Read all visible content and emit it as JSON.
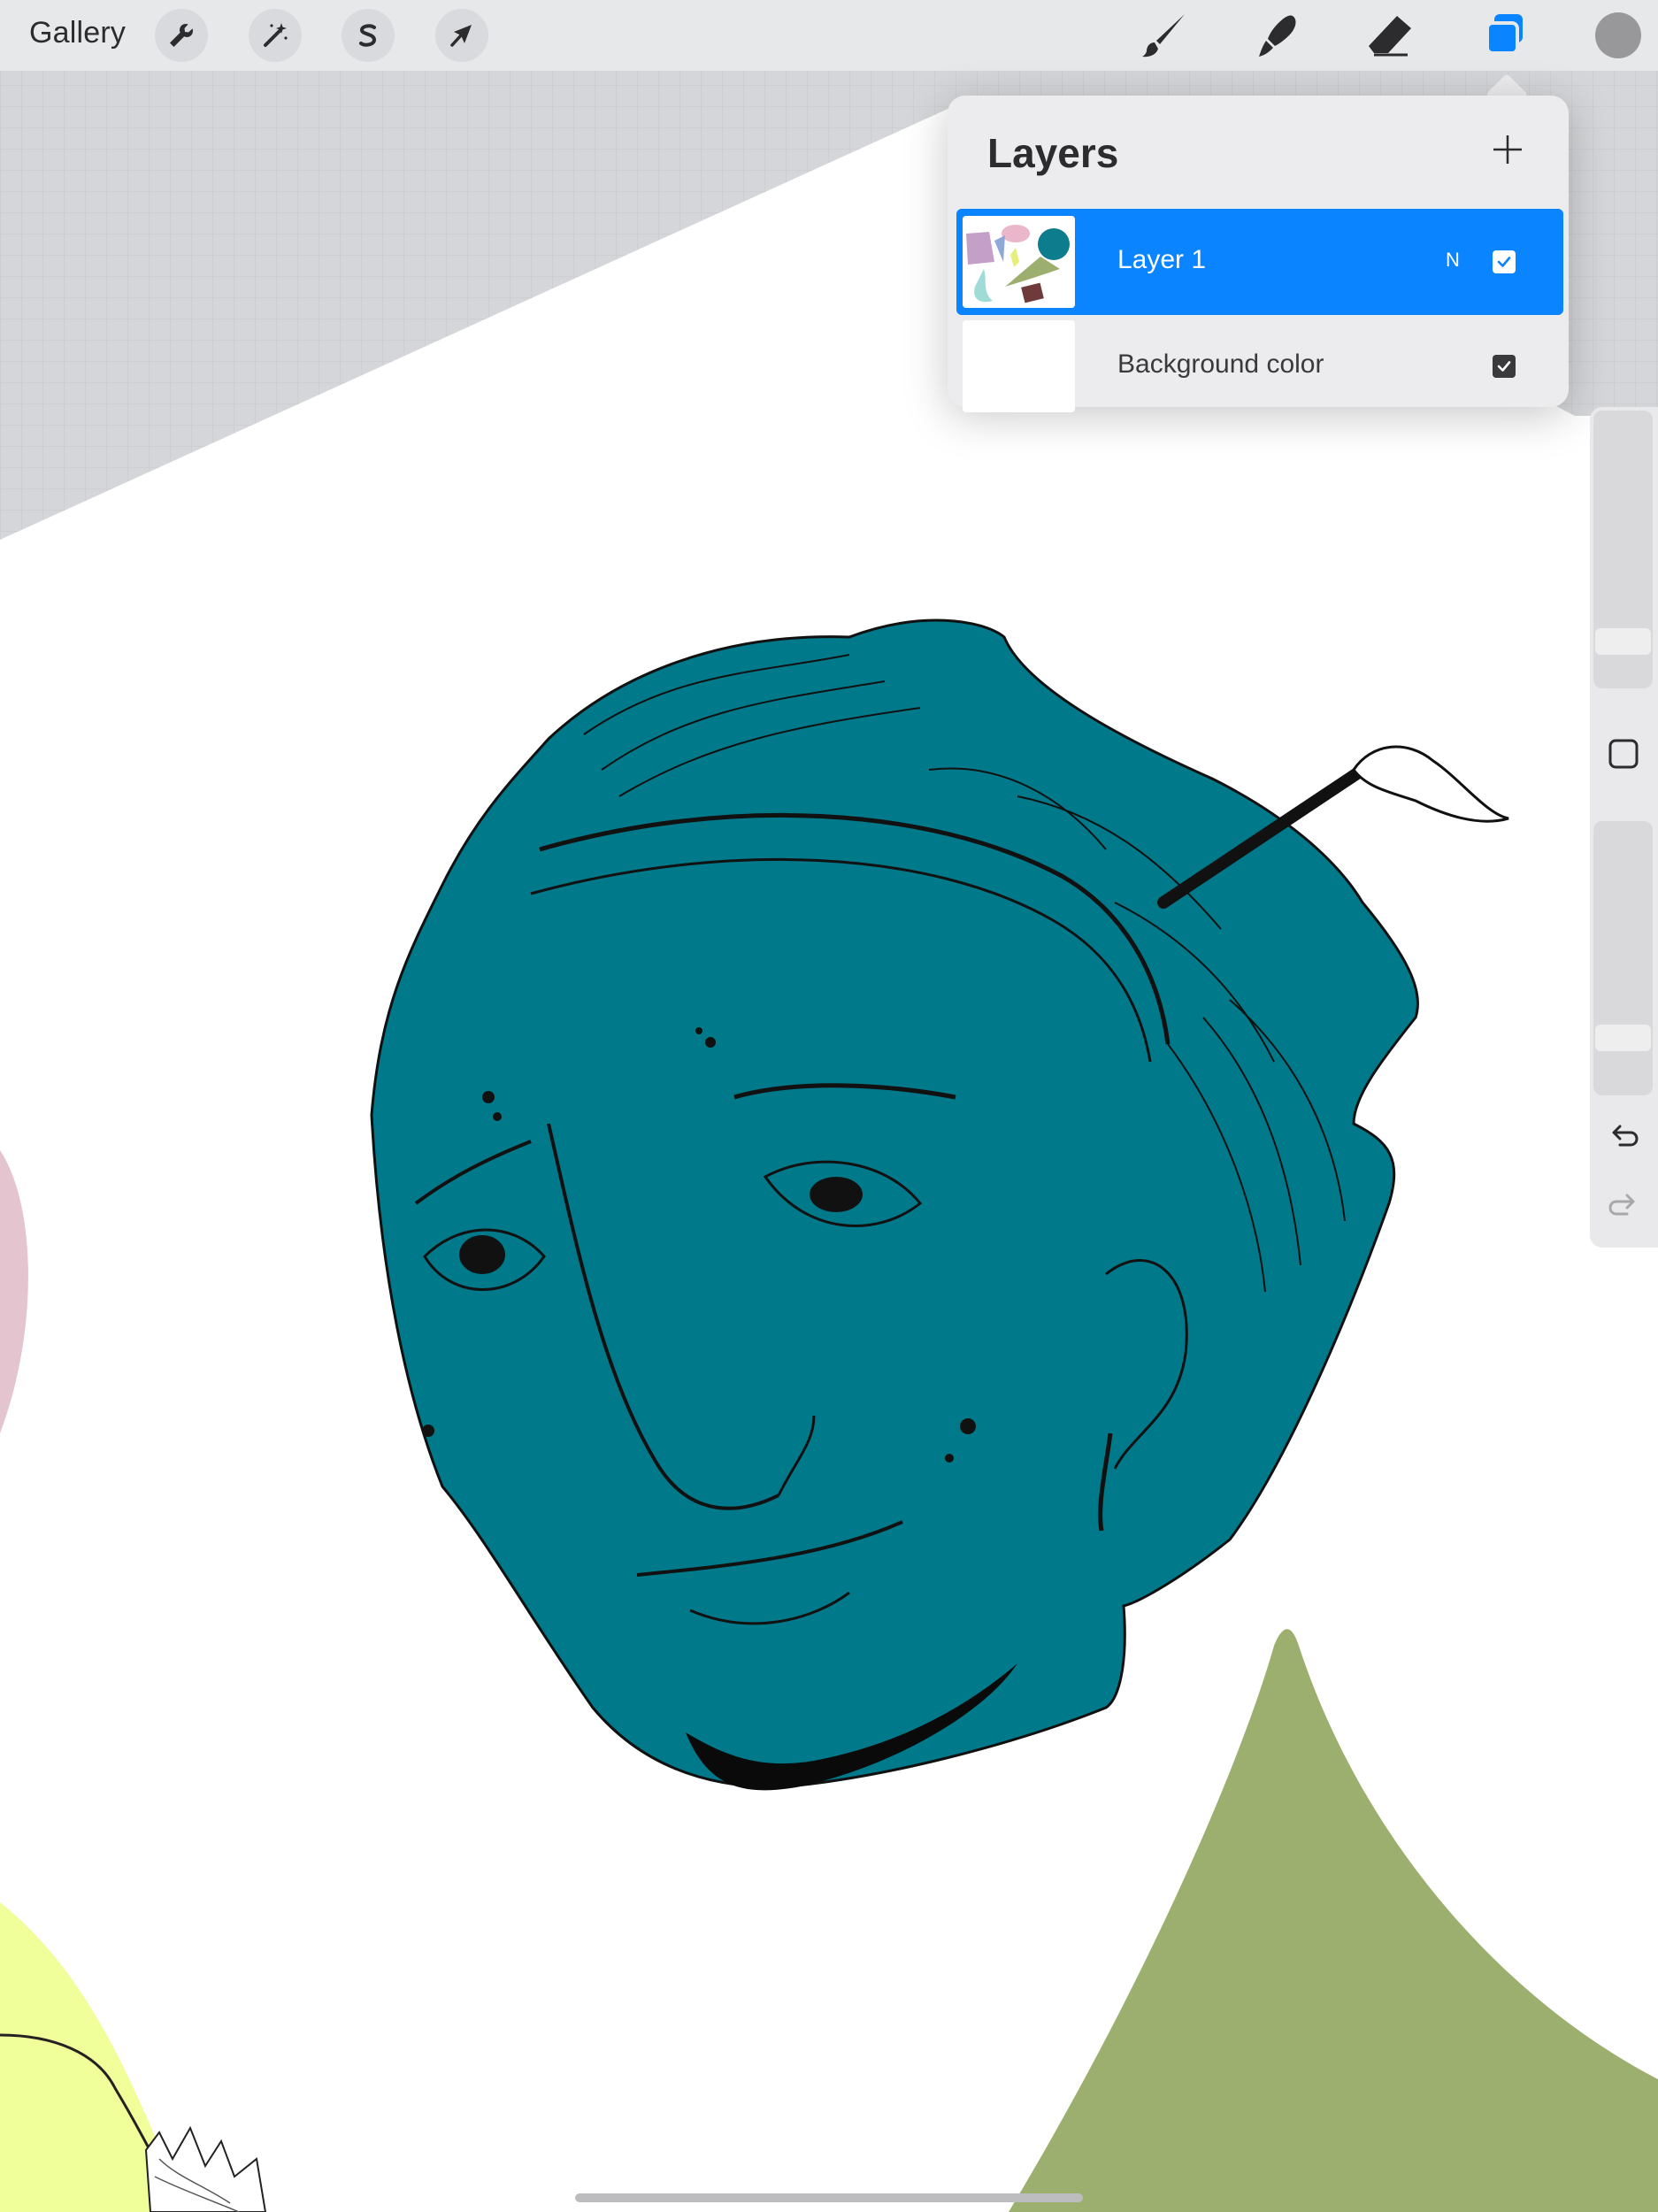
{
  "toolbar": {
    "gallery_label": "Gallery",
    "left_tools": [
      {
        "name": "actions",
        "icon": "wrench-icon"
      },
      {
        "name": "adjustments",
        "icon": "magic-wand-icon"
      },
      {
        "name": "selection",
        "icon": "selection-s-icon"
      },
      {
        "name": "transform",
        "icon": "arrow-cursor-icon"
      }
    ],
    "right_tools": [
      {
        "name": "brush",
        "icon": "brush-icon"
      },
      {
        "name": "smudge",
        "icon": "smudge-icon"
      },
      {
        "name": "eraser",
        "icon": "eraser-icon"
      },
      {
        "name": "layers",
        "icon": "layers-icon",
        "active": true
      }
    ],
    "current_color": "#98989b",
    "accent_color": "#0a84ff"
  },
  "layers_panel": {
    "title": "Layers",
    "add_icon": "plus-icon",
    "layers": [
      {
        "name": "Layer 1",
        "blend_mode": "N",
        "visible": true,
        "selected": true
      },
      {
        "name": "Background color",
        "visible": true,
        "selected": false
      }
    ]
  },
  "sidebar": {
    "brush_size_icon": "size-slider",
    "modify_button_icon": "square-icon",
    "opacity_icon": "opacity-slider",
    "undo_icon": "undo-icon",
    "redo_icon": "redo-icon"
  },
  "artwork": {
    "subject": "",
    "main_fill": "#00798a",
    "canvas_bg": "#ffffff",
    "grid_bg": "#d5d6d9",
    "accent_shapes": [
      "#e4c4cf",
      "#f0ff9a",
      "#9daf6e"
    ]
  }
}
